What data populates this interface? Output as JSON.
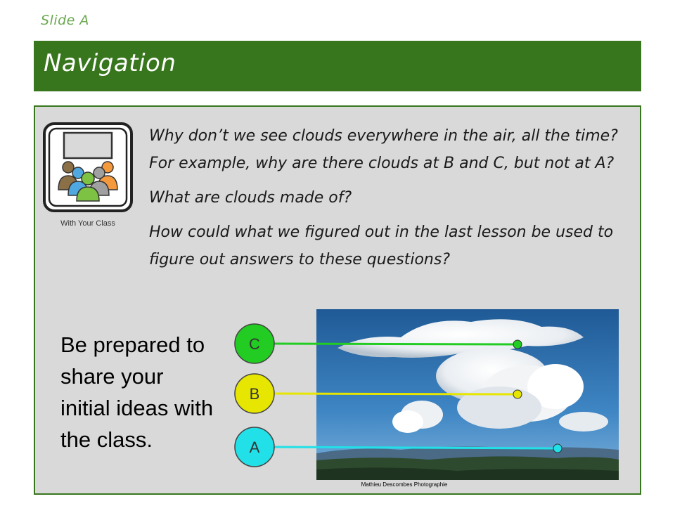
{
  "slide": {
    "label": "Slide A",
    "title": "Navigation"
  },
  "class_activity": {
    "icon": "class-discussion-icon",
    "caption": "With Your Class"
  },
  "questions": [
    "Why don’t we see clouds everywhere in the air, all the time? For example, why are there clouds at B and C, but not at A?",
    "What are clouds made of?",
    "How could what we figured out in the last lesson be used to figure out answers to these questions?"
  ],
  "prompt": "Be prepared to share your initial ideas with the class.",
  "photo": {
    "credit": "Mathieu Descombes Photographie",
    "markers": [
      {
        "label": "C",
        "color": "#22cc22"
      },
      {
        "label": "B",
        "color": "#e6e600"
      },
      {
        "label": "A",
        "color": "#22e0e8"
      }
    ]
  },
  "colors": {
    "title_bar": "#38761d",
    "slide_label": "#6aa84f",
    "content_bg": "#d9d9d9"
  }
}
